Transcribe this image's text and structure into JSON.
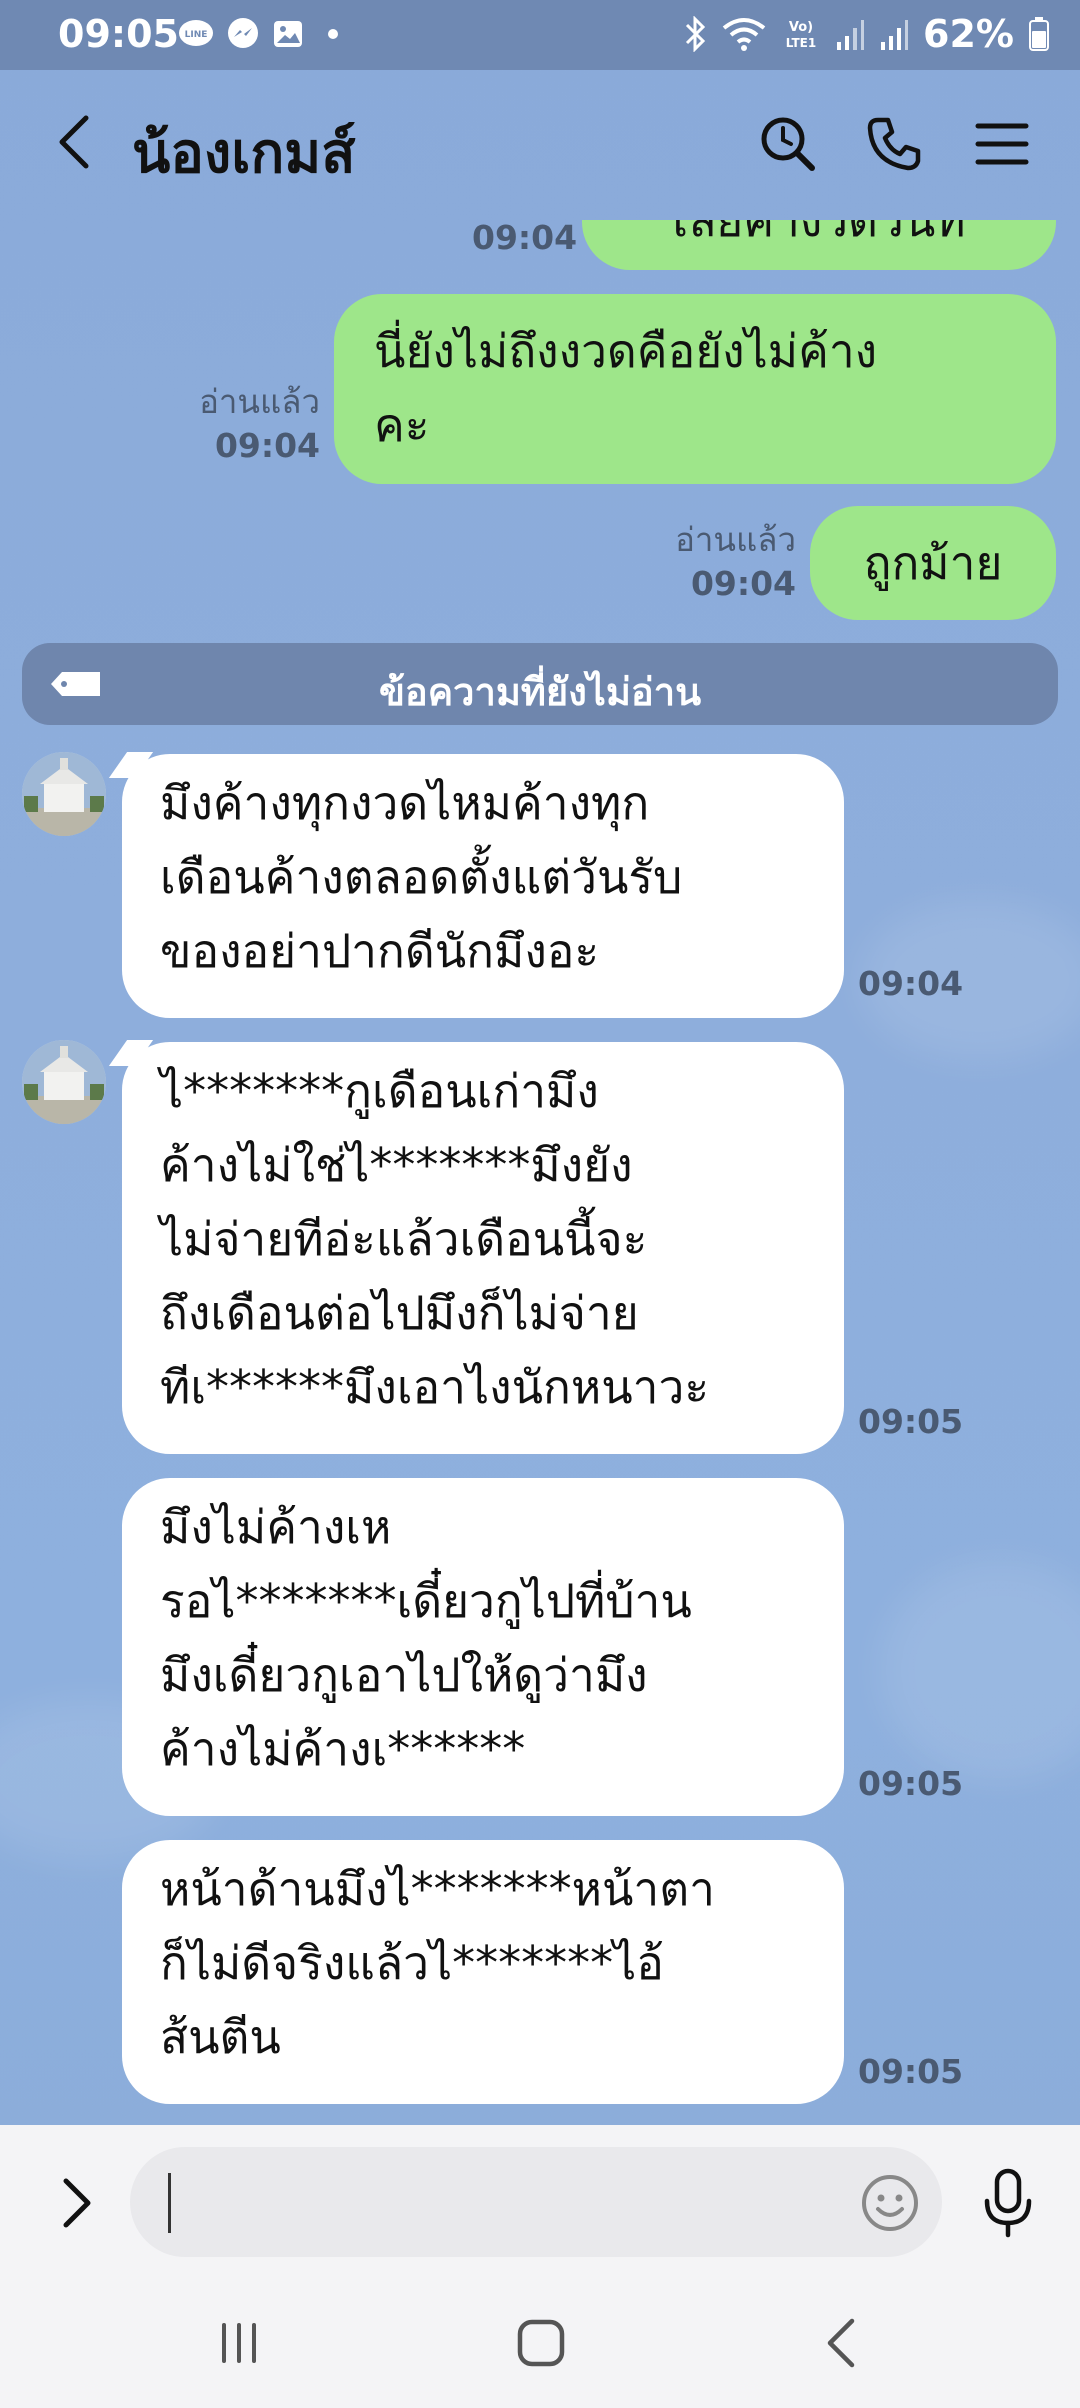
{
  "status_bar": {
    "time": "09:05",
    "battery": "62%",
    "icons": [
      "line-icon",
      "messenger-icon",
      "gallery-icon",
      "bluetooth-icon",
      "wifi-icon",
      "volte-icon",
      "signal-icon",
      "battery-icon"
    ],
    "volte_label": "Vo) LTE1"
  },
  "header": {
    "title": "น้องเกมส์",
    "actions": [
      "search-icon",
      "phone-icon",
      "menu-icon"
    ]
  },
  "messages": {
    "partial_prev": {
      "text": "เลยค้างวดวันที่",
      "time": "09:04"
    },
    "sent_1": {
      "lines": [
        "นี่ยังไม่ถึงงวดคือยังไม่ค้าง",
        "คะ"
      ],
      "read": "อ่านแล้ว",
      "time": "09:04"
    },
    "sent_2": {
      "text": "ถูกม้าย",
      "read": "อ่านแล้ว",
      "time": "09:04"
    },
    "unread_label": "ข้อความที่ยังไม่อ่าน",
    "recv_1": {
      "lines": [
        "มึงค้างทุกงวดไหมค้างทุก",
        "เดือนค้างตลอดตั้งแต่วันรับ",
        "ของอย่าปากดีนักมึงอะ"
      ],
      "time": "09:04"
    },
    "recv_2": {
      "lines": [
        "ไ*******กูเดือนเก่ามึง",
        "ค้างไม่ใช่ไ*******มึงยัง",
        "ไม่จ่ายทีอ่ะแล้วเดือนนี้จะ",
        "ถึงเดือนต่อไปมึงก็ไม่จ่าย",
        "ทีเ******มึงเอาไงนักหนาวะ"
      ],
      "time": "09:05"
    },
    "recv_3": {
      "lines": [
        "มึงไม่ค้างเห",
        "รอไ*******เดี๋ยวกูไปที่บ้าน",
        "มึงเดี๋ยวกูเอาไปให้ดูว่ามึง",
        "ค้างไม่ค้างเ******"
      ],
      "time": "09:05"
    },
    "recv_4": {
      "lines": [
        "หน้าด้านมึงไ*******หน้าตา",
        "ก็ไม่ดีจริงแล้วไ*******ไอ้",
        "ส้นตีน"
      ],
      "time": "09:05"
    }
  },
  "input": {
    "value": "",
    "placeholder": ""
  },
  "colors": {
    "chat_bg": "#8eaedc",
    "sent_bubble": "#9ee68a",
    "recv_bubble": "#ffffff",
    "status_bar": "#6f89b3",
    "unread_bar": "#6f86ad"
  }
}
